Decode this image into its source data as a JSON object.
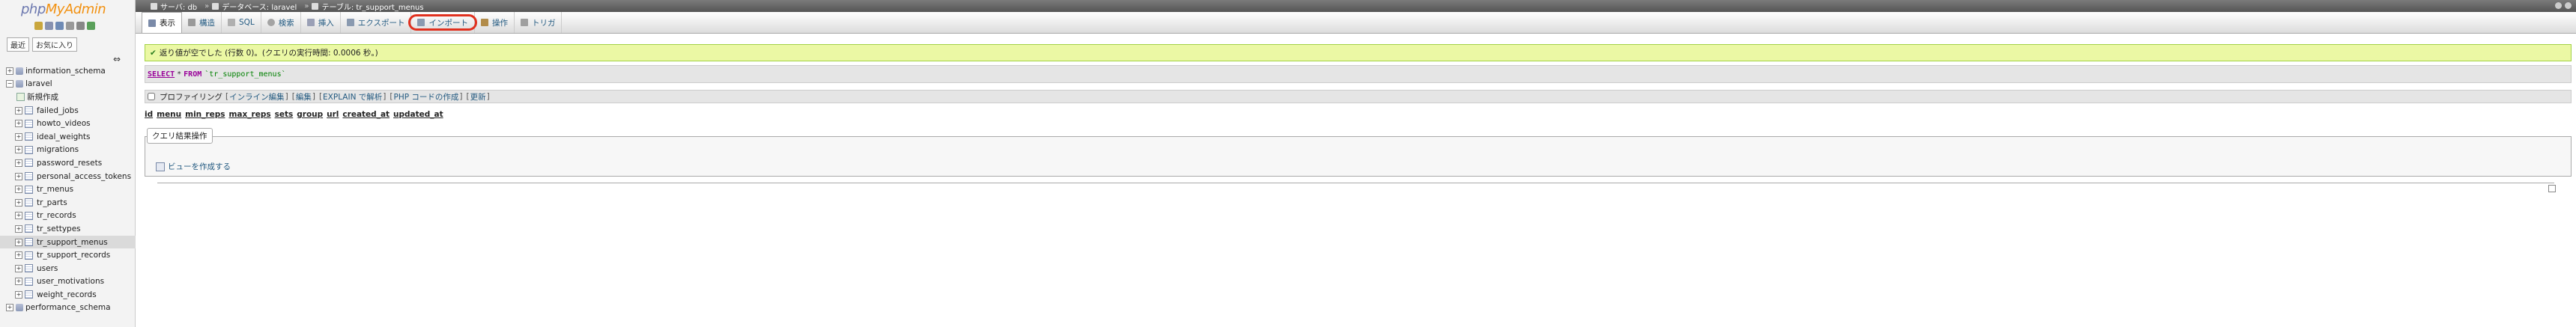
{
  "logo": {
    "part1": "php",
    "part2": "MyAdmin"
  },
  "nav": {
    "tabs": [
      "最近",
      "お気に入り"
    ],
    "databases": [
      {
        "name": "information_schema",
        "expanded": false
      },
      {
        "name": "laravel",
        "expanded": true
      },
      {
        "name": "performance_schema",
        "expanded": false
      }
    ],
    "new_item": "新規作成",
    "tables": [
      "failed_jobs",
      "howto_videos",
      "ideal_weights",
      "migrations",
      "password_resets",
      "personal_access_tokens",
      "tr_menus",
      "tr_parts",
      "tr_records",
      "tr_settypes",
      "tr_support_menus",
      "tr_support_records",
      "users",
      "user_motivations",
      "weight_records"
    ],
    "active_table": "tr_support_menus"
  },
  "breadcrumb": [
    {
      "label": "サーバ: db"
    },
    {
      "label": "データベース: laravel"
    },
    {
      "label": "テーブル: tr_support_menus"
    }
  ],
  "tabs": [
    "表示",
    "構造",
    "SQL",
    "検索",
    "挿入",
    "エクスポート",
    "インポート",
    "操作",
    "トリガ"
  ],
  "active_tab": "表示",
  "highlighted_tab": "インポート",
  "success_message": "返り値が空でした (行数 0)。(クエリの実行時間: 0.0006 秒。)",
  "sql": {
    "select": "SELECT",
    "star": "*",
    "from": "FROM",
    "table": "`tr_support_menus`"
  },
  "links": {
    "profiling": "プロファイリング",
    "items": [
      "インライン編集",
      "編集",
      "EXPLAIN で解析",
      "PHP コードの作成",
      "更新"
    ]
  },
  "columns": [
    "id",
    "menu",
    "min_reps",
    "max_reps",
    "sets",
    "group",
    "url",
    "created_at",
    "updated_at"
  ],
  "query_ops": {
    "legend": "クエリ結果操作",
    "create_view": "ビューを作成する"
  },
  "colors": {
    "accent": "#235a81",
    "success_bg": "#ebf8a4",
    "highlight_ring": "#e0301e"
  }
}
